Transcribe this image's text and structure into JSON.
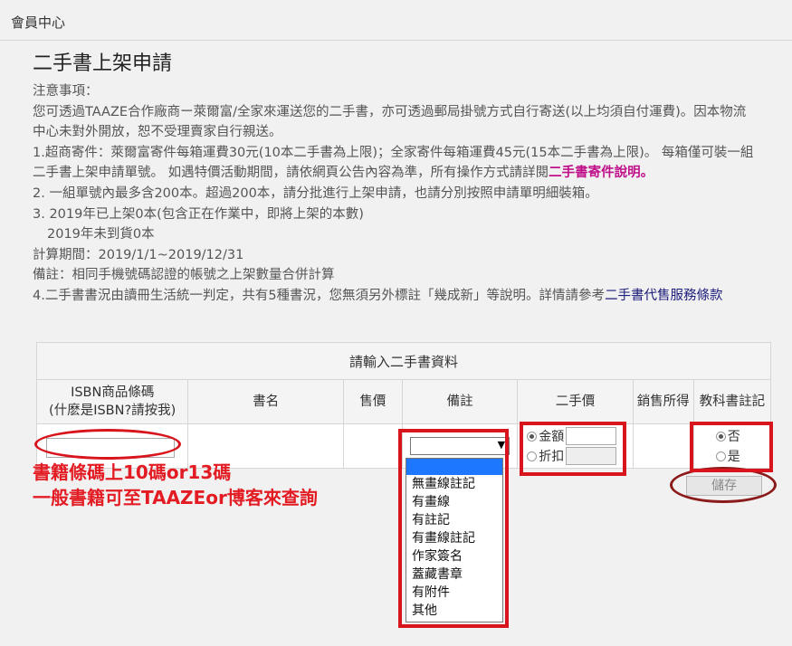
{
  "header": {
    "title": "會員中心"
  },
  "page": {
    "title": "二手書上架申請",
    "notice": {
      "heading": "注意事項：",
      "p1": "您可透過TAAZE合作廠商ー萊爾富/全家來運送您的二手書，亦可透過郵局掛號方式自行寄送(以上均須自付運費)。因本物流中心未對外開放，恕不受理賣家自行親送。",
      "p2_text": "1.超商寄件：萊爾富寄件每箱運費30元(10本二手書為上限)；全家寄件每箱運費45元(15本二手書為上限)。 每箱僅可裝一組二手書上架申請單號。 如遇特價活動期間，請依網頁公告內容為準，所有操作方式請詳閱",
      "p2_link": "二手書寄件說明。",
      "p3": "2. 一組單號內最多含200本。超過200本，請分批進行上架申請，也請分別按照申請單明細裝箱。",
      "p4": "3. 2019年已上架0本(包含正在作業中，即將上架的本數)",
      "p5": "2019年未到貨0本",
      "p6": "計算期間：2019/1/1~2019/12/31",
      "p7": "備註：相同手機號碼認證的帳號之上架數量合併計算",
      "p8_text": "4.二手書書況由讀冊生活統一判定，共有5種書況，您無須另外標註「幾成新」等說明。詳情請參考",
      "p8_link": "二手書代售服務條款"
    }
  },
  "form": {
    "caption": "請輸入二手書資料",
    "columns": {
      "isbn": "ISBN商品條碼",
      "isbn_hint": "(什麽是ISBN?請按我)",
      "book_name": "書名",
      "price": "售價",
      "notes": "備註",
      "used_price": "二手價",
      "sold": "銷售所得",
      "textbook": "教科書註記"
    },
    "used_price_options": {
      "amount": "金額",
      "discount": "折扣"
    },
    "textbook_options": {
      "no": "否",
      "yes": "是"
    },
    "notes_options": [
      "",
      "無畫線註記",
      "有畫線",
      "有註記",
      "有畫線註記",
      "作家簽名",
      "蓋藏書章",
      "有附件",
      "其他"
    ],
    "save_label": "儲存"
  },
  "annotation": {
    "line1": "書籍條碼上10碼or13碼",
    "line2": "一般書籍可至TAAZEor博客來查詢",
    "color": "#e31b23"
  },
  "colors": {
    "highlight": "#1e78ff",
    "link_pink": "#c0108a",
    "link_navy": "#1a1a7a"
  }
}
